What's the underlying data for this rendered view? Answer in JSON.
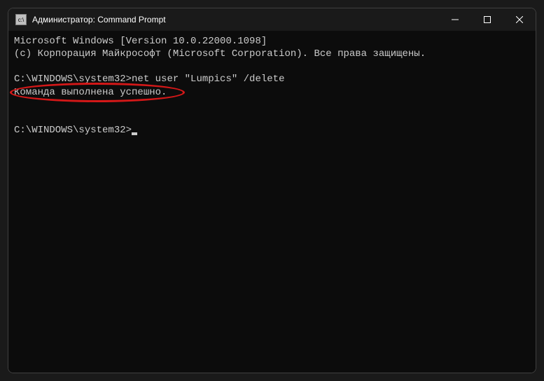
{
  "window": {
    "title": "Администратор: Command Prompt"
  },
  "terminal": {
    "line1": "Microsoft Windows [Version 10.0.22000.1098]",
    "line2": "(c) Корпорация Майкрософт (Microsoft Corporation). Все права защищены.",
    "prompt1": "C:\\WINDOWS\\system32>",
    "command1": "net user \"Lumpics\" /delete",
    "result": "Команда выполнена успешно.",
    "prompt2": "C:\\WINDOWS\\system32>"
  }
}
